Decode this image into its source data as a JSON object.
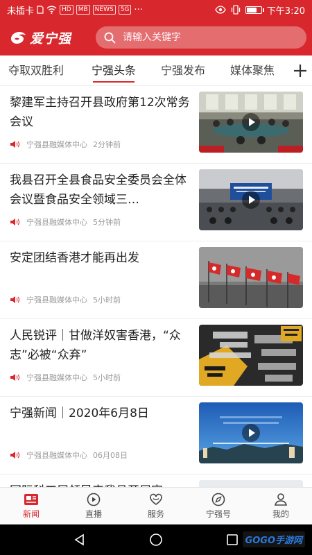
{
  "status_bar": {
    "carrier": "未插卡",
    "chips": [
      "HD",
      "MB",
      "NEWS",
      "5G"
    ],
    "more": "···",
    "time": "下午3:20",
    "battery_level": 0.75
  },
  "header": {
    "app_name": "爱宁强",
    "search_placeholder": "请输入关键字"
  },
  "tabs": [
    {
      "label": "夺取双胜利",
      "active": false
    },
    {
      "label": "宁强头条",
      "active": true
    },
    {
      "label": "宁强发布",
      "active": false
    },
    {
      "label": "媒体聚焦",
      "active": false
    }
  ],
  "articles": [
    {
      "title": "黎建军主持召开县政府第12次常务会议",
      "source": "宁强县融媒体中心",
      "time": "2分钟前",
      "thumb": "meeting-hall",
      "video": true
    },
    {
      "title": "我县召开全县食品安全委员会全体会议暨食品安全领域三…",
      "source": "宁强县融媒体中心",
      "time": "5分钟前",
      "thumb": "conference",
      "video": true
    },
    {
      "title": "安定团结香港才能再出发",
      "source": "宁强县融媒体中心",
      "time": "5小时前",
      "thumb": "flags",
      "video": false
    },
    {
      "title": "人民锐评｜甘做洋奴害香港，“众志”必被“众弃”",
      "source": "宁强县融媒体中心",
      "time": "5小时前",
      "thumb": "commentary",
      "video": false
    },
    {
      "title": "宁强新闻｜2020年6月8日",
      "source": "宁强县融媒体中心",
      "time": "06月08日",
      "thumb": "news-title",
      "video": true
    },
    {
      "title": "国际科工展领导来我县开展字",
      "source": "",
      "time": "",
      "thumb": "partial",
      "video": false
    }
  ],
  "bottom_nav": [
    {
      "label": "新闻",
      "icon": "news-icon",
      "active": true
    },
    {
      "label": "直播",
      "icon": "live-play-icon",
      "active": false
    },
    {
      "label": "服务",
      "icon": "service-heart-icon",
      "active": false
    },
    {
      "label": "宁强号",
      "icon": "compass-icon",
      "active": false
    },
    {
      "label": "我的",
      "icon": "user-icon",
      "active": false
    }
  ],
  "watermark": "GOGO手游网",
  "colors": {
    "accent": "#d8282d",
    "text": "#222222",
    "meta": "#9a9a9a"
  }
}
